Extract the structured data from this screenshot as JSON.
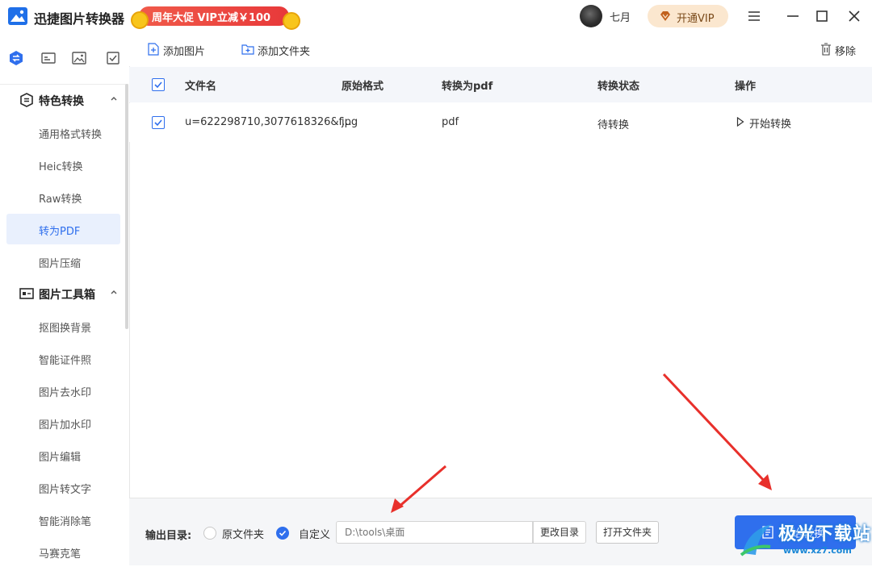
{
  "app": {
    "title": "迅捷图片转换器",
    "promo": "周年大促 VIP立减￥100",
    "user_name": "七月",
    "vip_button": "开通VIP"
  },
  "sidebar": {
    "groups": [
      {
        "label": "特色转换",
        "items": [
          "通用格式转换",
          "Heic转换",
          "Raw转换",
          "转为PDF",
          "图片压缩"
        ]
      },
      {
        "label": "图片工具箱",
        "items": [
          "抠图换背景",
          "智能证件照",
          "图片去水印",
          "图片加水印",
          "图片编辑",
          "图片转文字",
          "智能消除笔",
          "马赛克笔"
        ]
      }
    ],
    "active_item": "转为PDF"
  },
  "toolbar": {
    "add_image": "添加图片",
    "add_folder": "添加文件夹",
    "remove": "移除"
  },
  "table": {
    "columns": [
      "文件名",
      "原始格式",
      "转换为pdf",
      "转换状态",
      "操作"
    ],
    "rows": [
      {
        "checked": true,
        "filename": "u=622298710,3077618326&f...",
        "orig_format": "jpg",
        "target": "pdf",
        "status": "待转换",
        "action": "开始转换"
      }
    ]
  },
  "bottom": {
    "output_label": "输出目录:",
    "option_original": "原文件夹",
    "option_custom": "自定义",
    "selected_option": "自定义",
    "path_placeholder": "D:\\tools\\桌面",
    "change_dir": "更改目录",
    "open_folder": "打开文件夹",
    "convert_all": "开始转换"
  },
  "watermark": {
    "text": "极光下载站",
    "url": "www.xz7.com"
  },
  "colors": {
    "accent": "#2f6fed",
    "promo": "#e8393a",
    "annotation_arrow": "#e8302b"
  }
}
